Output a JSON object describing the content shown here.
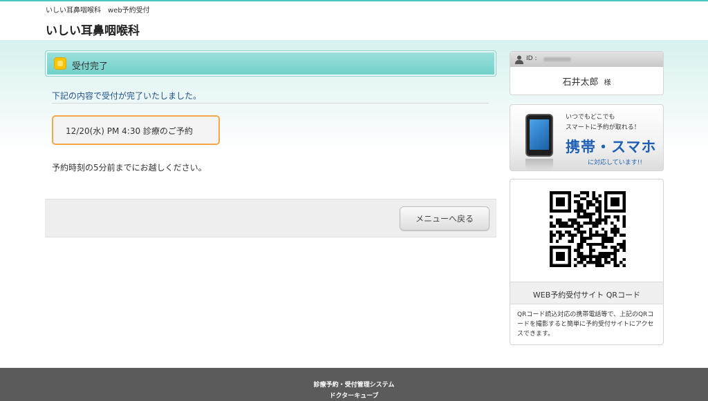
{
  "header": {
    "subtitle": "いしい耳鼻咽喉科　web予約受付",
    "title": "いしい耳鼻咽喉科"
  },
  "main": {
    "section_title": "受付完了",
    "done_message": "下記の内容で受付が完了いたしました。",
    "appointment": "12/20(水) PM 4:30 診療のご予約",
    "note": "予約時刻の5分前までにお越しください。",
    "back_button": "メニューへ戻る"
  },
  "user": {
    "id_label": "ID :",
    "name": "石井太郎",
    "honorific": "様"
  },
  "mobile_banner": {
    "line1": "いつでもどこでも",
    "line2": "スマートに予約が取れる！",
    "headline": "携帯・スマホ",
    "line3": "に対応しています!!"
  },
  "qr": {
    "title": "WEB予約受付サイト QRコード",
    "description": "QRコード読込対応の携帯電話等で、上記のQRコードを撮影すると簡単に予約受付サイトにアクセスできます。"
  },
  "footer": {
    "system_name": "診療予約・受付管理システム",
    "product_name": "ドクターキューブ"
  },
  "colors": {
    "accent": "#4dc3bd",
    "link_blue": "#1d4f8a",
    "highlight_border": "#f5a54a",
    "banner_blue": "#1f5fb6"
  }
}
